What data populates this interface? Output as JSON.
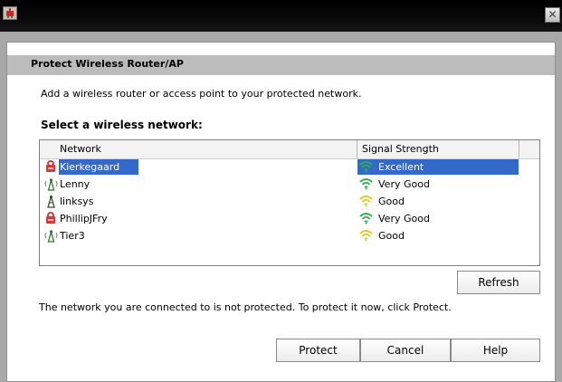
{
  "window": {
    "close_glyph": "✕"
  },
  "dialog": {
    "title": "Protect Wireless Router/AP",
    "intro": "Add a wireless router or access point to your protected network.",
    "select_label": "Select a wireless network:",
    "columns": {
      "network": "Network",
      "signal": "Signal Strength"
    },
    "networks": [
      {
        "name": "Kierkegaard",
        "signal": "Excellent",
        "icon": "router-protected-icon",
        "signal_color": "#2bb24b",
        "selected": true
      },
      {
        "name": "Lenny",
        "signal": "Very Good",
        "icon": "access-point-icon",
        "signal_color": "#2bb24b",
        "selected": false
      },
      {
        "name": "linksys",
        "signal": "Good",
        "icon": "tower-icon",
        "signal_color": "#e6c619",
        "selected": false
      },
      {
        "name": "PhillipJFry",
        "signal": "Very Good",
        "icon": "router-protected-icon",
        "signal_color": "#2bb24b",
        "selected": false
      },
      {
        "name": "Tier3",
        "signal": "Good",
        "icon": "access-point-icon",
        "signal_color": "#e6c619",
        "selected": false
      }
    ],
    "refresh_label": "Refresh",
    "status_text": "The network you are connected to is not protected.  To protect it now, click Protect.",
    "buttons": {
      "protect": "Protect",
      "cancel": "Cancel",
      "help": "Help"
    }
  },
  "colors": {
    "selection": "#3369c9",
    "header_band": "#bcbcbc"
  }
}
